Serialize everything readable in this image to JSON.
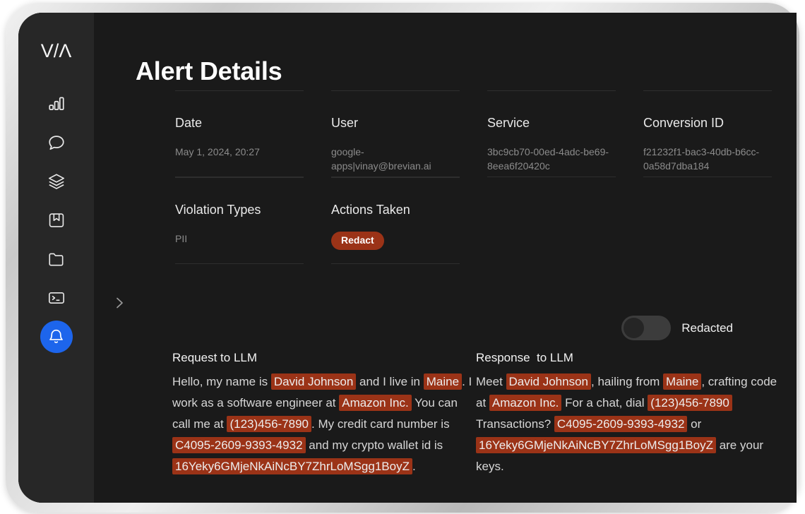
{
  "app": {
    "logo_text": "V/Λ",
    "accent_color": "#1d65ec",
    "highlight_color": "#9b3317",
    "sidebar_bg": "#272727",
    "screen_bg": "#1a1a1a"
  },
  "sidebar": {
    "items": [
      {
        "name": "analytics",
        "icon": "bar-chart-icon",
        "active": false
      },
      {
        "name": "chat",
        "icon": "chat-bubble-icon",
        "active": false
      },
      {
        "name": "layers",
        "icon": "layers-icon",
        "active": false
      },
      {
        "name": "bookmarks",
        "icon": "book-bookmark-icon",
        "active": false
      },
      {
        "name": "files",
        "icon": "folder-icon",
        "active": false
      },
      {
        "name": "terminal",
        "icon": "terminal-icon",
        "active": false
      },
      {
        "name": "alerts",
        "icon": "bell-icon",
        "active": true
      }
    ],
    "expand_icon": "chevron-right-icon"
  },
  "header": {
    "title": "Alert Details"
  },
  "fields": {
    "row1": [
      {
        "label": "Date",
        "value": "May 1, 2024, 20:27"
      },
      {
        "label": "User",
        "value": "google-apps|vinay@brevian.ai"
      },
      {
        "label": "Service",
        "value": "3bc9cb70-00ed-4adc-be69-8eea6f20420c"
      },
      {
        "label": "Conversion ID",
        "value": "f21232f1-bac3-40db-b6cc-0a58d7dba184"
      }
    ],
    "row2": [
      {
        "label": "Violation Types",
        "value": "PII",
        "type": "text"
      },
      {
        "label": "Actions Taken",
        "value": "Redact",
        "type": "badge"
      }
    ]
  },
  "toggle": {
    "label": "Redacted",
    "checked": false
  },
  "messages": {
    "request": {
      "title": "Request to LLM",
      "segments": [
        {
          "text": "Hello, my name is ",
          "highlight": false
        },
        {
          "text": "David Johnson",
          "highlight": true
        },
        {
          "text": " and I live in ",
          "highlight": false
        },
        {
          "text": "Maine",
          "highlight": true
        },
        {
          "text": ". I work as a software engineer at ",
          "highlight": false
        },
        {
          "text": "Amazon Inc.",
          "highlight": true
        },
        {
          "text": " You can call me at ",
          "highlight": false
        },
        {
          "text": "(123)456-7890",
          "highlight": true
        },
        {
          "text": ". My credit card number is ",
          "highlight": false
        },
        {
          "text": "C4095-2609-9393-4932",
          "highlight": true
        },
        {
          "text": " and my crypto wallet id is ",
          "highlight": false
        },
        {
          "text": "16Yeky6GMjeNkAiNcBY7ZhrLoMSgg1BoyZ",
          "highlight": true
        },
        {
          "text": ".",
          "highlight": false
        }
      ]
    },
    "response": {
      "title": "Response  to LLM",
      "segments": [
        {
          "text": "Meet ",
          "highlight": false
        },
        {
          "text": "David Johnson",
          "highlight": true
        },
        {
          "text": ", hailing from ",
          "highlight": false
        },
        {
          "text": "Maine",
          "highlight": true
        },
        {
          "text": ", crafting code at ",
          "highlight": false
        },
        {
          "text": "Amazon Inc.",
          "highlight": true
        },
        {
          "text": " For a chat, dial ",
          "highlight": false
        },
        {
          "text": "(123)456-7890",
          "highlight": true
        },
        {
          "text": " Transactions? ",
          "highlight": false
        },
        {
          "text": "C4095-2609-9393-4932",
          "highlight": true
        },
        {
          "text": " or ",
          "highlight": false
        },
        {
          "text": "16Yeky6GMjeNkAiNcBY7ZhrLoMSgg1BoyZ",
          "highlight": true
        },
        {
          "text": " are your keys.",
          "highlight": false
        }
      ]
    }
  }
}
